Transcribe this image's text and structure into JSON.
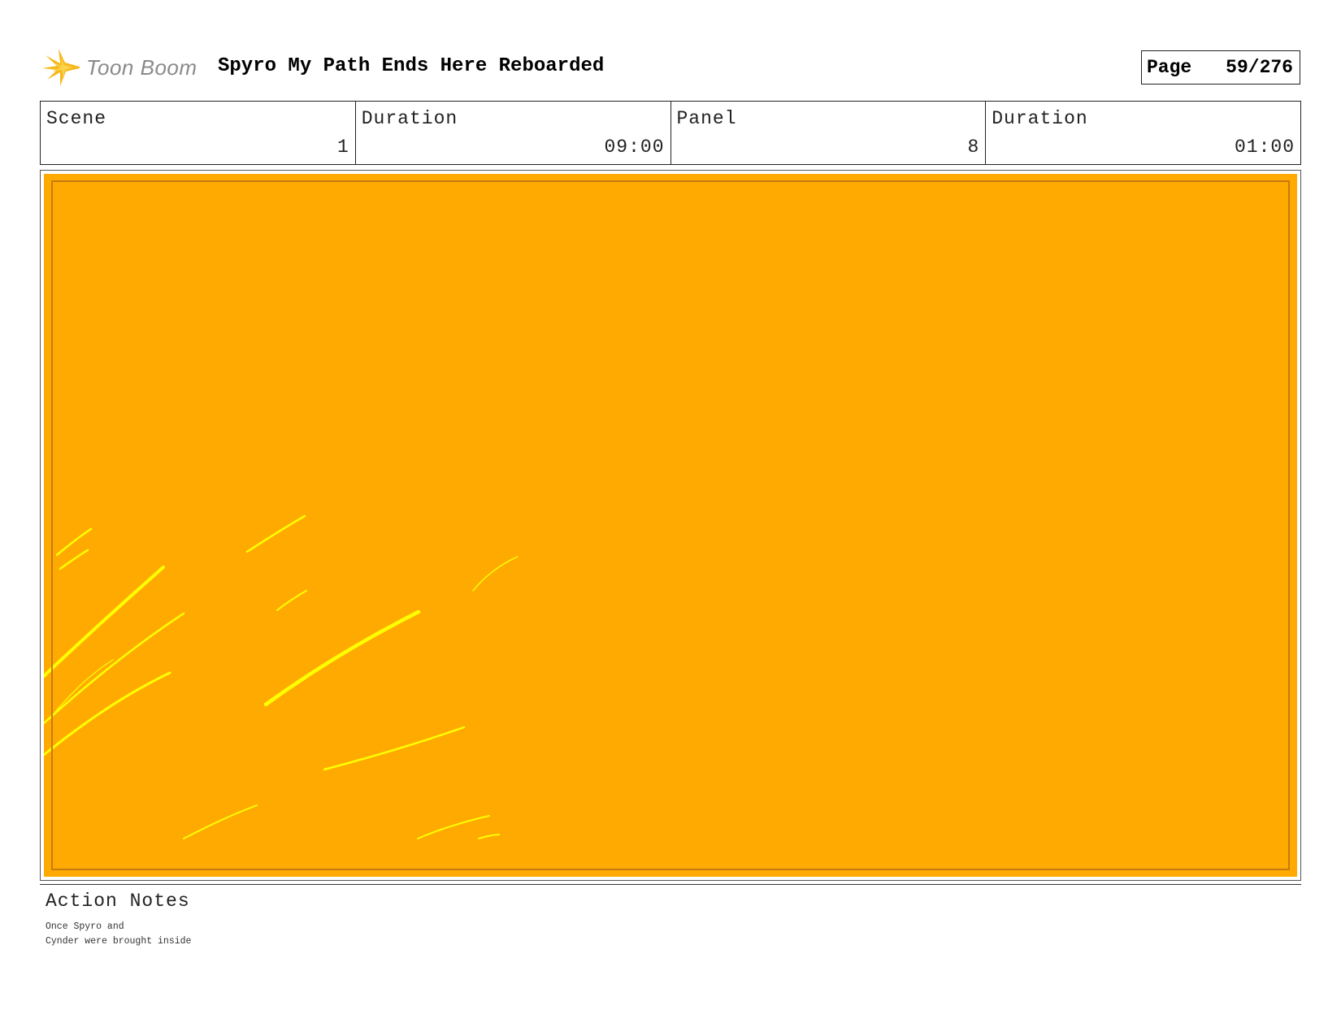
{
  "logo": {
    "text": "Toon Boom",
    "icon": "starburst-logo-icon",
    "accent": "#f6b81c"
  },
  "header": {
    "project_title": "Spyro My Path Ends Here Reboarded",
    "page_label": "Page",
    "page_value": "59/276"
  },
  "info": {
    "scene_label": "Scene",
    "scene_value": "1",
    "scene_duration_label": "Duration",
    "scene_duration_value": "09:00",
    "panel_label": "Panel",
    "panel_value": "8",
    "panel_duration_label": "Duration",
    "panel_duration_value": "01:00"
  },
  "panel": {
    "background": "#ffaa00",
    "stroke_color": "#ffff00",
    "border_color": "#c77a10"
  },
  "notes": {
    "label": "Action Notes",
    "text": "Once Spyro and\nCynder were brought inside"
  }
}
